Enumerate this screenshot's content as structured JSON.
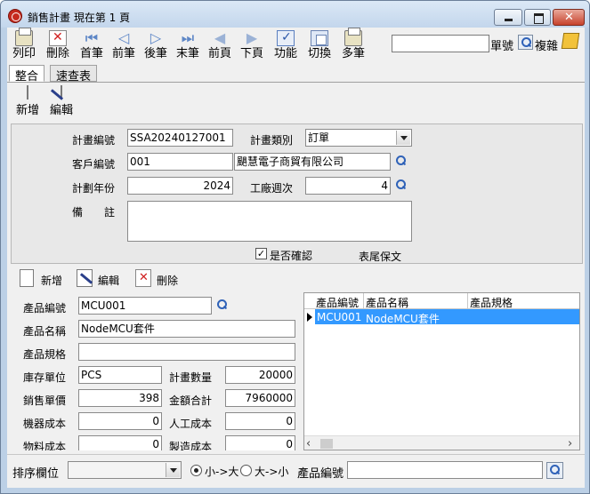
{
  "window": {
    "title": "銷售計畫  現在第 1 頁"
  },
  "toolbar": {
    "print": "列印",
    "delete": "刪除",
    "first": "首筆",
    "prev": "前筆",
    "next": "後筆",
    "last": "末筆",
    "prev_page": "前頁",
    "next_page": "下頁",
    "function": "功能",
    "switch": "切換",
    "multi": "多筆",
    "search_value": "",
    "doc_no_label": "單號",
    "copy_label": "複雜"
  },
  "tabs": [
    {
      "label": "整合"
    },
    {
      "label": "速查表"
    }
  ],
  "record_toolbar": {
    "add": "新增",
    "edit": "編輯"
  },
  "master": {
    "plan_no_label": "計畫編號",
    "plan_no": "SSA20240127001",
    "plan_type_label": "計畫類別",
    "plan_type": "訂單",
    "customer_no_label": "客戶編號",
    "customer_no": "001",
    "customer_name": "颶慧電子商貿有限公司",
    "plan_year_label": "計劃年份",
    "plan_year": "2024",
    "work_week_label": "工廠週次",
    "work_week": "4",
    "remark_label": "備　　註",
    "remark": "",
    "confirmed_label": "是否確認",
    "confirmed": true,
    "footer_text_label": "表尾保文"
  },
  "detail_toolbar": {
    "add": "新增",
    "edit": "編輯",
    "delete": "刪除"
  },
  "detail": {
    "product_no_label": "產品編號",
    "product_no": "MCU001",
    "product_name_label": "產品名稱",
    "product_name": "NodeMCU套件",
    "product_spec_label": "產品規格",
    "product_spec": "",
    "stock_unit_label": "庫存單位",
    "stock_unit": "PCS",
    "plan_qty_label": "計畫數量",
    "plan_qty": "20000",
    "sale_price_label": "銷售單價",
    "sale_price": "398",
    "total_amount_label": "金額合計",
    "total_amount": "7960000",
    "machine_cost_label": "機器成本",
    "machine_cost": "0",
    "labor_cost_label": "人工成本",
    "labor_cost": "0",
    "material_cost_label": "物料成本",
    "material_cost": "0",
    "mfg_cost_label": "製造成本",
    "mfg_cost": "0"
  },
  "grid": {
    "columns": [
      "產品編號",
      "產品名稱",
      "產品規格"
    ],
    "rows": [
      {
        "product_no": "MCU001",
        "product_name": "NodeMCU套件",
        "spec": ""
      }
    ]
  },
  "bottom": {
    "sort_label": "排序欄位",
    "sort_value": "",
    "asc_label": "小->大",
    "desc_label": "大->小",
    "asc_selected": true,
    "search_label": "產品編號",
    "search_value": ""
  }
}
